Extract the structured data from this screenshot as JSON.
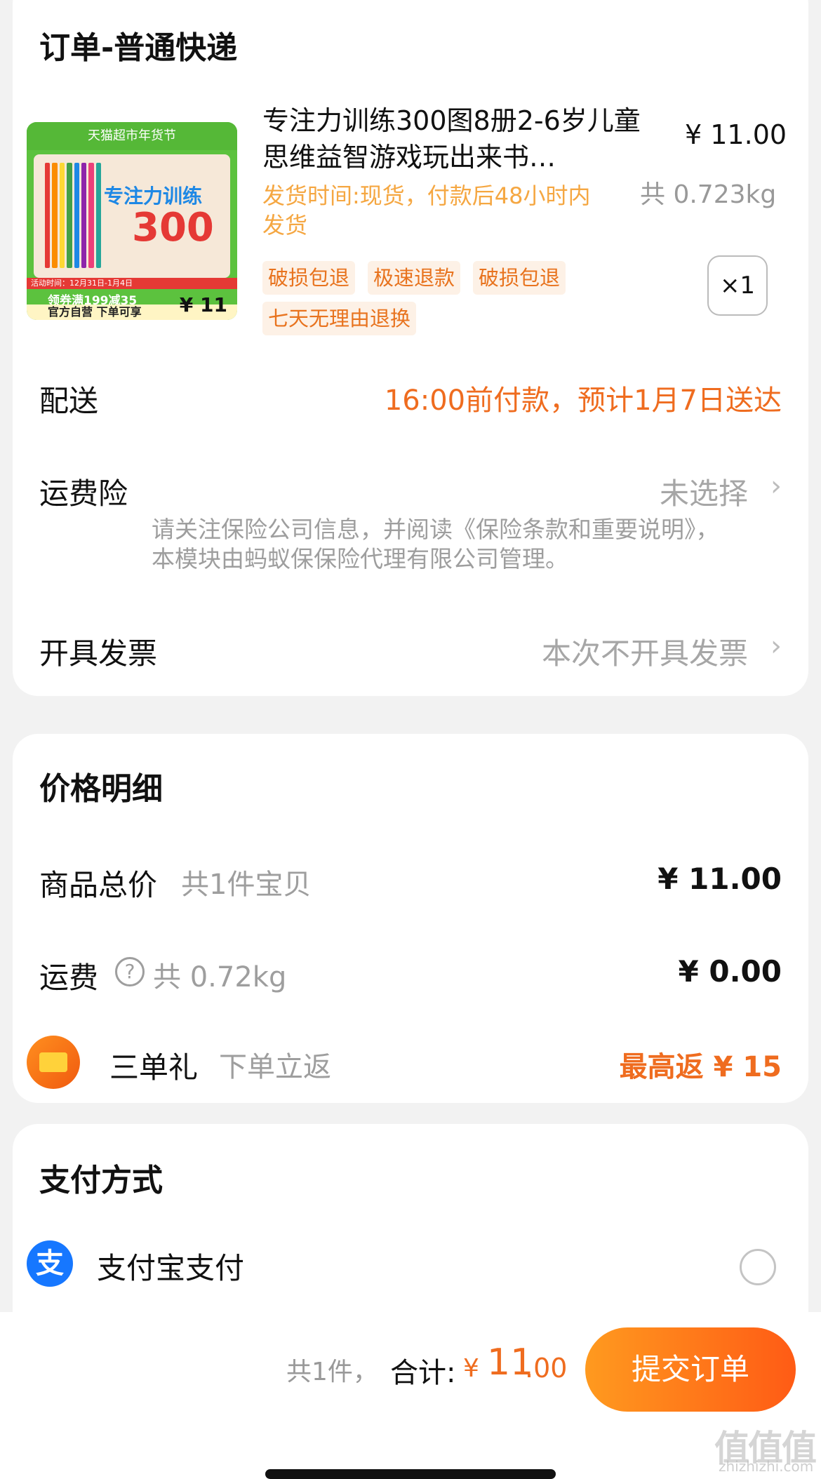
{
  "order": {
    "title": "订单-普通快递",
    "product": {
      "image": {
        "banner": "天猫超市年货节",
        "book_title": "专注力训练",
        "big_number": "300",
        "date_strip": "活动时间：12月31日-1月4日",
        "coupon": "领券满199减35",
        "bottom_text": "官方自营 下单可享",
        "price_tag": "¥ 11"
      },
      "title": "专注力训练300图8册2-6岁儿童思维益智游戏玩出来书…",
      "price": "¥ 11.00",
      "weight": "共 0.723kg",
      "ship_time": "发货时间:现货，付款后48小时内发货",
      "tags": [
        "破损包退",
        "极速退款",
        "破损包退",
        "七天无理由退换"
      ],
      "quantity": "×1"
    },
    "delivery": {
      "label": "配送",
      "value": "16:00前付款，预计1月7日送达"
    },
    "insurance": {
      "label": "运费险",
      "value": "未选择",
      "notice": "请关注保险公司信息，并阅读《保险条款和重要说明》，本模块由蚂蚁保保险代理有限公司管理。"
    },
    "invoice": {
      "label": "开具发票",
      "value": "本次不开具发票"
    }
  },
  "price_detail": {
    "title": "价格明细",
    "goods_total": {
      "label": "商品总价",
      "sub": "共1件宝贝",
      "value": "¥ 11.00"
    },
    "shipping": {
      "label": "运费",
      "help_icon": "?",
      "sub": "共 0.72kg",
      "value": "¥ 0.00"
    },
    "gift": {
      "label": "三单礼",
      "sub": "下单立返",
      "value": "最高返 ¥ 15"
    }
  },
  "payment": {
    "title": "支付方式",
    "alipay": {
      "icon": "支",
      "label": "支付宝支付"
    }
  },
  "footer": {
    "count": "共1件，",
    "total_label": "合计:",
    "currency": "¥",
    "amount_int": "11",
    "amount_dec": ".00",
    "submit": "提交订单"
  },
  "watermark": {
    "main": "值值值",
    "sub": "zhizhizhi.com"
  },
  "colors": {
    "accent": "#ef6c1f",
    "ship_time": "#f5a742",
    "alipay": "#1677ff"
  }
}
